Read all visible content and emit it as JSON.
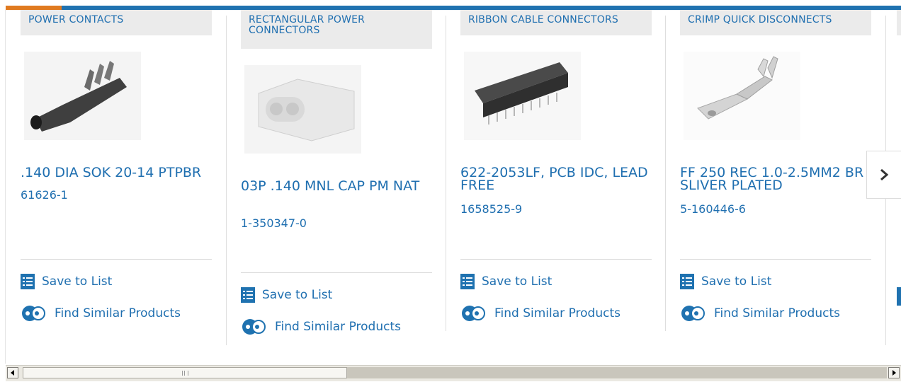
{
  "products": [
    {
      "category": "POWER CONTACTS",
      "name": ".140 DIA SOK 20-14 PTPBR",
      "part_number": "61626-1",
      "image_icon": "power-contact-image",
      "save_label": "Save to List",
      "find_label": "Find Similar Products"
    },
    {
      "category": "RECTANGULAR POWER CONNECTORS",
      "name": "03P .140 MNL CAP PM NAT",
      "part_number": "1-350347-0",
      "image_icon": "rectangular-power-connector-image",
      "save_label": "Save to List",
      "find_label": "Find Similar Products"
    },
    {
      "category": "RIBBON CABLE CONNECTORS",
      "name": "622-2053LF, PCB IDC, LEAD FREE",
      "part_number": "1658525-9",
      "image_icon": "ribbon-cable-connector-image",
      "save_label": "Save to List",
      "find_label": "Find Similar Products"
    },
    {
      "category": "CRIMP QUICK DISCONNECTS",
      "name": "FF 250 REC 1.0-2.5MM2 BR SLIVER PLATED",
      "part_number": "5-160446-6",
      "image_icon": "crimp-quick-disconnect-image",
      "save_label": "Save to List",
      "find_label": "Find Similar Products"
    }
  ],
  "carousel": {
    "next_icon": "chevron-right-icon"
  },
  "scrollbar": {
    "left_icon": "arrow-left-icon",
    "right_icon": "arrow-right-icon"
  },
  "colors": {
    "link": "#1f6fb0",
    "accent_bar": "#1f72b0",
    "accent_orange": "#e07a20"
  }
}
